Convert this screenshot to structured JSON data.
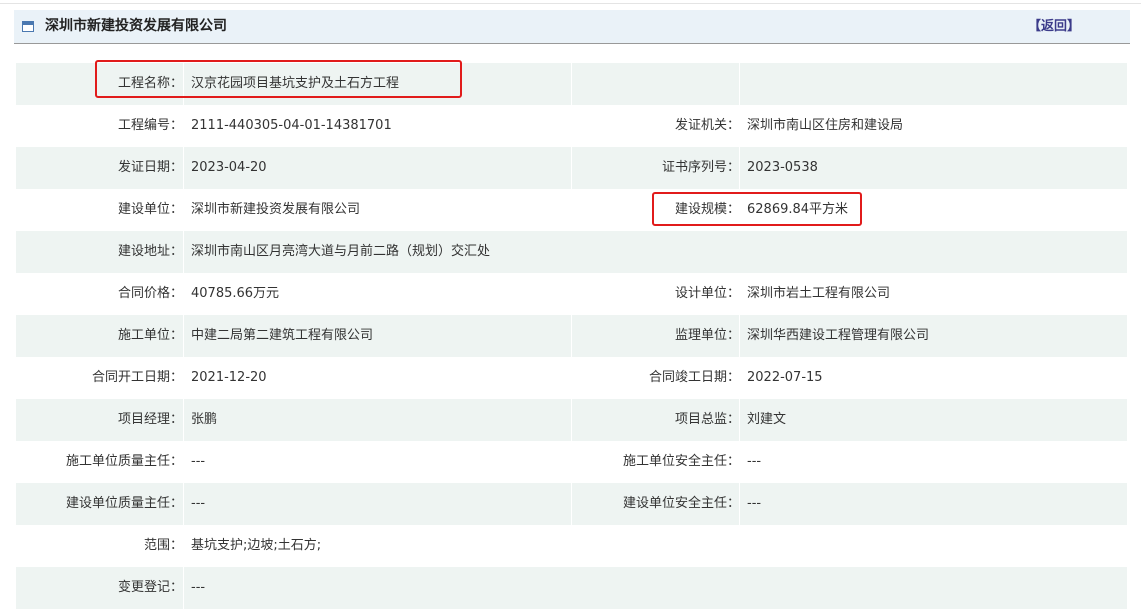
{
  "header": {
    "title": "深圳市新建投资发展有限公司",
    "back_label": "【返回】"
  },
  "rows": [
    {
      "label1": "工程名称：",
      "value1": "汉京花园项目基坑支护及土石方工程",
      "label2": "",
      "value2": ""
    },
    {
      "label1": "工程编号：",
      "value1": "2111-440305-04-01-14381701",
      "label2": "发证机关：",
      "value2": "深圳市南山区住房和建设局"
    },
    {
      "label1": "发证日期：",
      "value1": "2023-04-20",
      "label2": "证书序列号：",
      "value2": "2023-0538"
    },
    {
      "label1": "建设单位：",
      "value1": "深圳市新建投资发展有限公司",
      "label2": "建设规模：",
      "value2": "62869.84平方米"
    },
    {
      "label1": "建设地址：",
      "value1": "深圳市南山区月亮湾大道与月前二路（规划）交汇处",
      "label2": "",
      "value2": ""
    },
    {
      "label1": "合同价格：",
      "value1": "40785.66万元",
      "label2": "设计单位：",
      "value2": "深圳市岩土工程有限公司"
    },
    {
      "label1": "施工单位：",
      "value1": "中建二局第二建筑工程有限公司",
      "label2": "监理单位：",
      "value2": "深圳华西建设工程管理有限公司"
    },
    {
      "label1": "合同开工日期：",
      "value1": "2021-12-20",
      "label2": "合同竣工日期：",
      "value2": "2022-07-15"
    },
    {
      "label1": "项目经理：",
      "value1": "张鹏",
      "label2": "项目总监：",
      "value2": "刘建文"
    },
    {
      "label1": "施工单位质量主任：",
      "value1": "---",
      "label2": "施工单位安全主任：",
      "value2": "---"
    },
    {
      "label1": "建设单位质量主任：",
      "value1": "---",
      "label2": "建设单位安全主任：",
      "value2": "---"
    },
    {
      "label1": "范围：",
      "value1": "基坑支护;边坡;土石方;",
      "label2": "",
      "value2": ""
    },
    {
      "label1": "变更登记：",
      "value1": "---",
      "label2": "",
      "value2": ""
    }
  ],
  "colors": {
    "header_bg": "#eaf2f8",
    "row_alt_bg": "#eef4f2",
    "highlight": "#e11b1b",
    "back_link": "#3b3b8a"
  }
}
